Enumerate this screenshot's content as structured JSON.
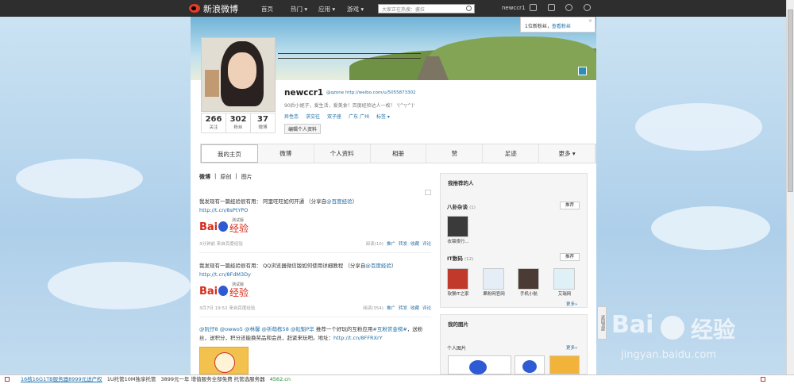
{
  "topbar": {
    "logo_text": "新浪微博",
    "nav": [
      "首页",
      "热门 ▾",
      "应用 ▾",
      "游戏 ▾"
    ],
    "search_placeholder": "大家正在热搜：酱拉",
    "username": "newccr1"
  },
  "notification": {
    "text": "1位新粉丝，",
    "link": "查看粉丝"
  },
  "profile": {
    "name": "newccr1",
    "domain": "http://weibo.com/u/5055873302",
    "badge": "@qzone",
    "bio": "90后小妮子，爱生活，爱美食！百度经验达人一枚！ '(^▽^)'",
    "tags": [
      "异性恋",
      "求交往",
      "双子座",
      "广东 广州",
      "标签 ▾"
    ],
    "edit_button": "编辑个人资料",
    "stats": [
      {
        "value": "266",
        "label": "关注"
      },
      {
        "value": "302",
        "label": "粉丝"
      },
      {
        "value": "37",
        "label": "微博"
      }
    ]
  },
  "tabs": [
    "我的主页",
    "微博",
    "个人资料",
    "相册",
    "赞",
    "足迹",
    "更多 ▾"
  ],
  "feed": {
    "filters": [
      "微博",
      "原创",
      "图片"
    ],
    "posts": [
      {
        "text": "我发现有一篇经验很有用： 阿里旺旺如何开通 （分享自",
        "source_link": "@百度经验",
        "suffix": "）",
        "url": "http://t.cn/8sPtYPO",
        "time": "3分钟前",
        "via": "来自百度经验",
        "actions": [
          "阅读(10)",
          "推广",
          "转发",
          "收藏",
          "评论"
        ]
      },
      {
        "text": "我发现有一篇经验很有用： QQ浏览器微信版如何使用详细教程 （分享自",
        "source_link": "@百度经验",
        "suffix": "）",
        "url": "http://t.cn/8FdM3Dy",
        "time": "3月7日 19:52",
        "via": "来自百度经验",
        "actions": [
          "阅读(354)",
          "推广",
          "转发",
          "收藏",
          "评论"
        ]
      },
      {
        "mentions": "@阮仔8 @owwo5 @林馨 @祈萌栋58 @耘魁P华",
        "text": "推荐一个好玩的互粉应用",
        "tag": "#互粉赏金榜#",
        "rest": "，送粉丝，送积分，积分还能换奖品和会员，赶紧来玩吧。地址：",
        "url": "http://t.cn/8FFRXrY"
      }
    ]
  },
  "baidu_logo": {
    "bai": "Bai",
    "du": "du",
    "jingyan": "经验",
    "beta": "测试版"
  },
  "sidebar": {
    "recommend_title": "我推荐的人",
    "group1": {
      "name": "八卦杂谈",
      "count": "(1)",
      "button": "推荐",
      "people": [
        "衣锦夜行..."
      ]
    },
    "group2": {
      "name": "IT数码",
      "count": "(12)",
      "button": "推荐",
      "people": [
        "软猴IT之家",
        "果粉网官网",
        "手机小航",
        "艾瑞网"
      ],
      "more": "更多»"
    },
    "photos_title": "我的图片",
    "photos_sub": "个人图片",
    "photos_more": "更多»"
  },
  "back_to_top": "返回顶部",
  "watermark": {
    "text": "Bai",
    "jingyan": "经验",
    "url": "jingyan.baidu.com"
  },
  "bottom_ads": [
    "16核16G1TB服务器8999元送产权",
    "1U托管10M独享托管",
    "3899元一年 增值服务全部免费 托管选服务器",
    "4562.cn"
  ]
}
